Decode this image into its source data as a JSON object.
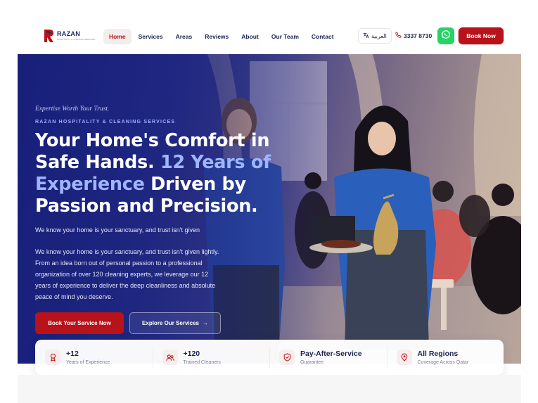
{
  "brand": {
    "name": "RAZAN",
    "sub": "HOSPITALITY & CLEANING SERVICES",
    "accent": "#b8121b",
    "navy": "#1d2454"
  },
  "nav": {
    "items": [
      {
        "label": "Home",
        "active": true
      },
      {
        "label": "Services"
      },
      {
        "label": "Areas"
      },
      {
        "label": "Reviews"
      },
      {
        "label": "About"
      },
      {
        "label": "Our Team"
      },
      {
        "label": "Contact"
      }
    ],
    "language_label": "العربية",
    "phone": "3337 8730",
    "whatsapp_icon": "whatsapp-icon",
    "book_label": "Book Now"
  },
  "hero": {
    "tagline": "Expertise Worth Your Trust.",
    "eyebrow": "RAZAN HOSPITALITY & CLEANING SERVICES",
    "headline_part1": "Your Home's Comfort in Safe Hands. ",
    "headline_accent1": "12 Years of",
    "headline_accent2": "Experience",
    "headline_part2": " Driven by Passion and Precision.",
    "ghost_line": "We know your home is your sanctuary, and trust isn't given",
    "description": "We know your home is your sanctuary, and trust isn't given lightly. From an idea born out of personal passion to a professional organization of over 120 cleaning experts, we leverage our 12 years of experience to deliver the deep cleanliness and absolute peace of mind you deserve.",
    "primary_cta": "Book Your Service Now",
    "secondary_cta": "Explore Our Services",
    "secondary_arrow": "→"
  },
  "stats": [
    {
      "value": "+12",
      "label": "Years of Experience",
      "icon": "award-icon"
    },
    {
      "value": "+120",
      "label": "Trained Cleaners",
      "icon": "users-icon"
    },
    {
      "value": "Pay-After-Service",
      "label": "Guarantee",
      "icon": "shield-icon"
    },
    {
      "value": "All Regions",
      "label": "Coverage Across Qatar",
      "icon": "map-pin-icon"
    }
  ]
}
